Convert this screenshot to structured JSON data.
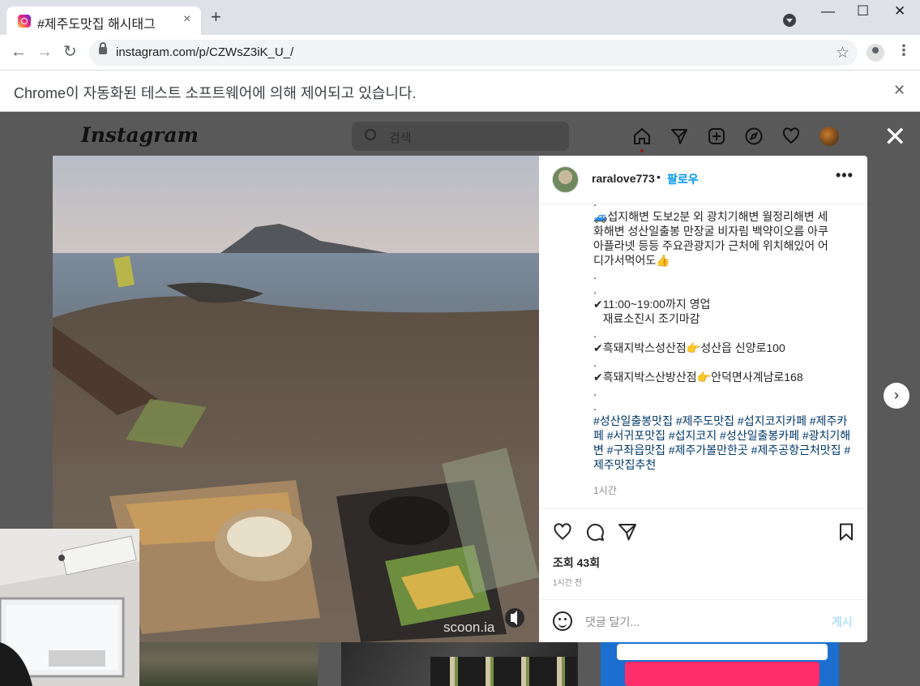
{
  "browser": {
    "tab_title": "#제주도맛집 해시태그",
    "tab_close": "×",
    "new_tab": "+",
    "url": "instagram.com/p/CZWsZ3iK_U_/",
    "minimize": "—",
    "maximize": "☐",
    "close": "✕",
    "back": "←",
    "forward": "→",
    "reload": "↻",
    "star": "☆",
    "menu": "⋮"
  },
  "infobar": {
    "message": "Chrome이 자동화된 테스트 소프트웨어에 의해 제어되고 있습니다.",
    "close": "✕"
  },
  "instagram": {
    "logo": "Instagram",
    "search_placeholder": "검색",
    "nav_icons": [
      "home-icon",
      "send-icon",
      "new-post-icon",
      "explore-icon",
      "heart-icon",
      "profile-avatar"
    ],
    "modal_close": "✕"
  },
  "post": {
    "username": "raralove773",
    "dot": "•",
    "follow_label": "팔로우",
    "more": "•••",
    "caption_lines": [
      ".",
      "🚙섭지해변 도보2분 외 광치기해변 월정리해변 세",
      "화해변 성산일출봉 만장굴 비자림 백약이오름 아쿠",
      "아플라넷 등등 주요관광지가 근처에 위치해있어 어",
      "디가서먹어도👍",
      ".",
      ".",
      "✔11:00~19:00까지 영업",
      "   재료소진시 조기마감",
      ".",
      "✔흑돼지박스성산점👉성산읍 신양로100",
      ".",
      "✔흑돼지박스산방산점👉안덕면사계남로168",
      ".",
      "."
    ],
    "hashtags": "#성산일출봉맛집 #제주도맛집 #섭지코지카페 #제주카페  #서귀포맛집  #섭지코지 #성산일출봉카페 #광치기해변 #구좌읍맛집 #제주가볼만한곳 #제주공항근처맛집 #제주맛집추천",
    "caption_time": "1시간",
    "views": "조회 43회",
    "posted_ago": "1시간 전",
    "comment_placeholder": "댓글 달기...",
    "post_button": "게시",
    "watermark": "scoon.ia",
    "next": "›"
  },
  "colors": {
    "accent": "#0095f6",
    "hashtag": "#00376b",
    "overlay": "#595959"
  }
}
